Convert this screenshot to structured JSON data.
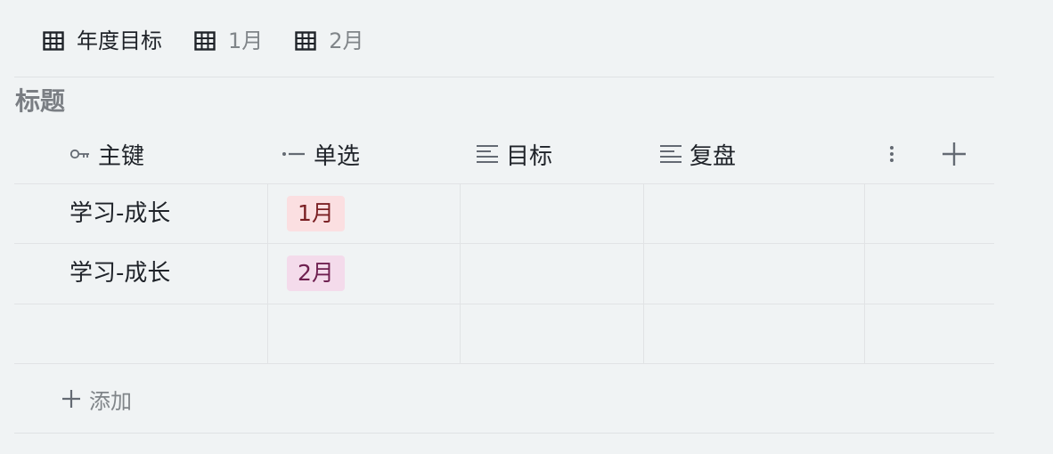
{
  "tabs": [
    {
      "label": "年度目标",
      "icon": "table-icon",
      "active": true
    },
    {
      "label": "1月",
      "icon": "table-icon",
      "active": false
    },
    {
      "label": "2月",
      "icon": "table-icon",
      "active": false
    }
  ],
  "section": {
    "title": "标题"
  },
  "columns": [
    {
      "label": "主键",
      "icon": "key-icon"
    },
    {
      "label": "单选",
      "icon": "single-select-icon"
    },
    {
      "label": "目标",
      "icon": "text-icon"
    },
    {
      "label": "复盘",
      "icon": "text-icon"
    }
  ],
  "header_actions": {
    "more_icon": "more-vertical-icon",
    "add_icon": "plus-icon"
  },
  "rows": [
    {
      "key": "学习-成长",
      "tag": "1月",
      "goal": "",
      "review": ""
    },
    {
      "key": "学习-成长",
      "tag": "2月",
      "goal": "",
      "review": ""
    },
    {
      "key": "",
      "tag": "",
      "goal": "",
      "review": ""
    }
  ],
  "tag_colors": {
    "1月": {
      "bg": "#fbdfe1",
      "fg": "#7a1f23"
    },
    "2月": {
      "bg": "#f4dbeb",
      "fg": "#6e1f4f"
    }
  },
  "add_row": {
    "label": "添加",
    "icon": "plus-icon"
  },
  "colors": {
    "background": "#f0f3f4",
    "grid_line": "#e1e3e5",
    "text": "#1f2329",
    "muted": "#808589"
  }
}
